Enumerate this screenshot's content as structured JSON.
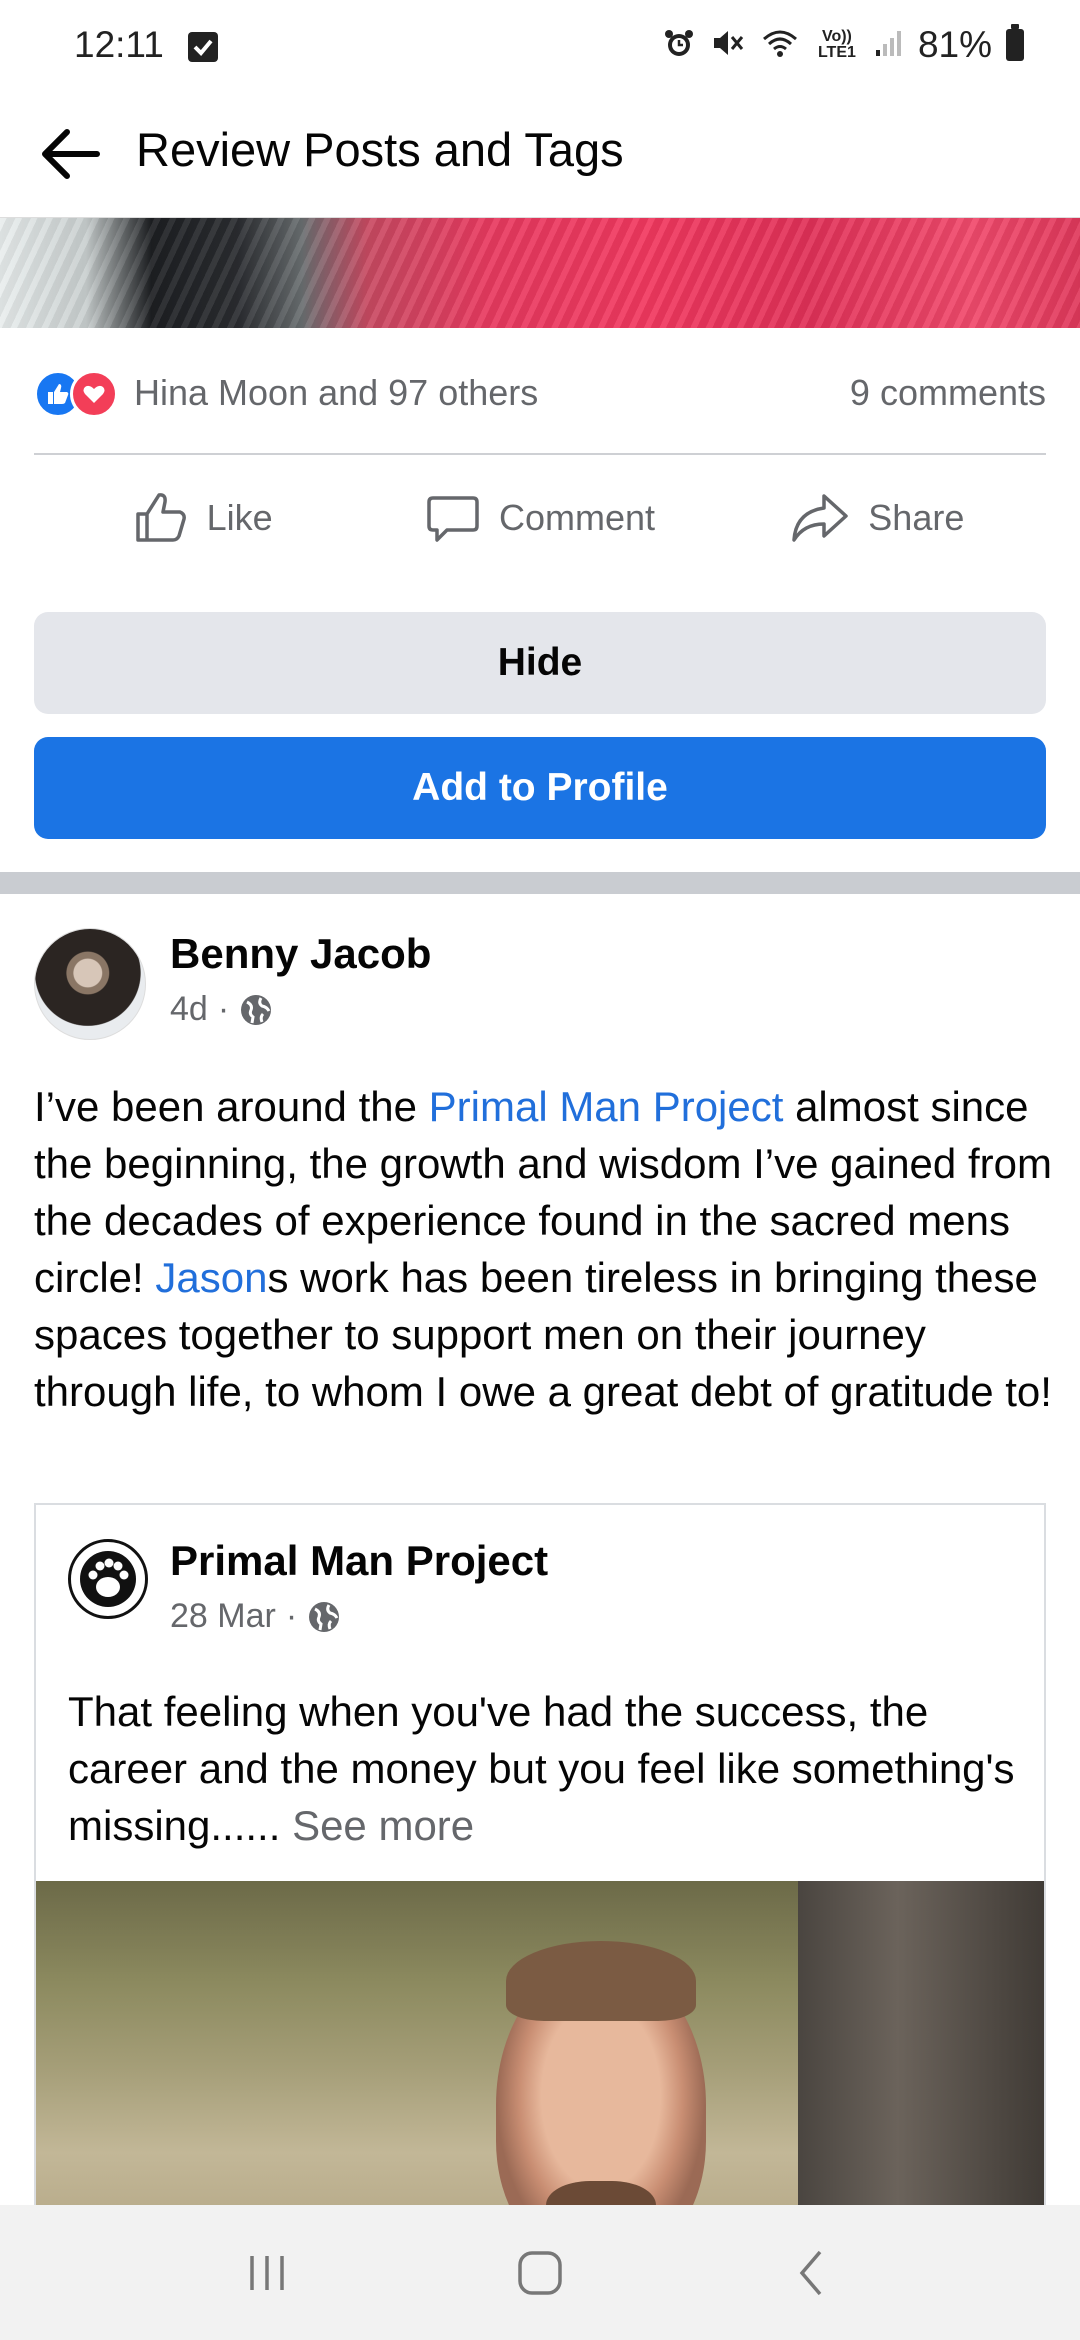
{
  "status_bar": {
    "time": "12:11",
    "lte_label": "Vo)) LTE1",
    "battery": "81%"
  },
  "header": {
    "title": "Review Posts and Tags"
  },
  "previous_post": {
    "reactions_text": "Hina Moon and 97 others",
    "comments_text": "9 comments",
    "actions": {
      "like": "Like",
      "comment": "Comment",
      "share": "Share"
    },
    "hide_label": "Hide",
    "add_label": "Add to Profile"
  },
  "post": {
    "author": "Benny Jacob",
    "time": "4d",
    "text_parts": {
      "p1": "I’ve been around the ",
      "link1": "Primal Man Project",
      "p2": " almost since the beginning, the growth and wisdom I’ve gained from the decades of experience found in the sacred mens circle! ",
      "link2": "Jason",
      "p3": "s work has been tireless in bringing these spaces together to support men on their journey through life, to whom I owe a great debt of gratitude to!"
    },
    "shared": {
      "page_name": "Primal Man Project",
      "date": "28 Mar",
      "text": "That feeling when you've had the success, the career and the money but you feel like something's missing......",
      "see_more": "See more"
    }
  },
  "colors": {
    "accent": "#1b74e4",
    "link": "#216fdb",
    "secondary_text": "#65676b"
  }
}
